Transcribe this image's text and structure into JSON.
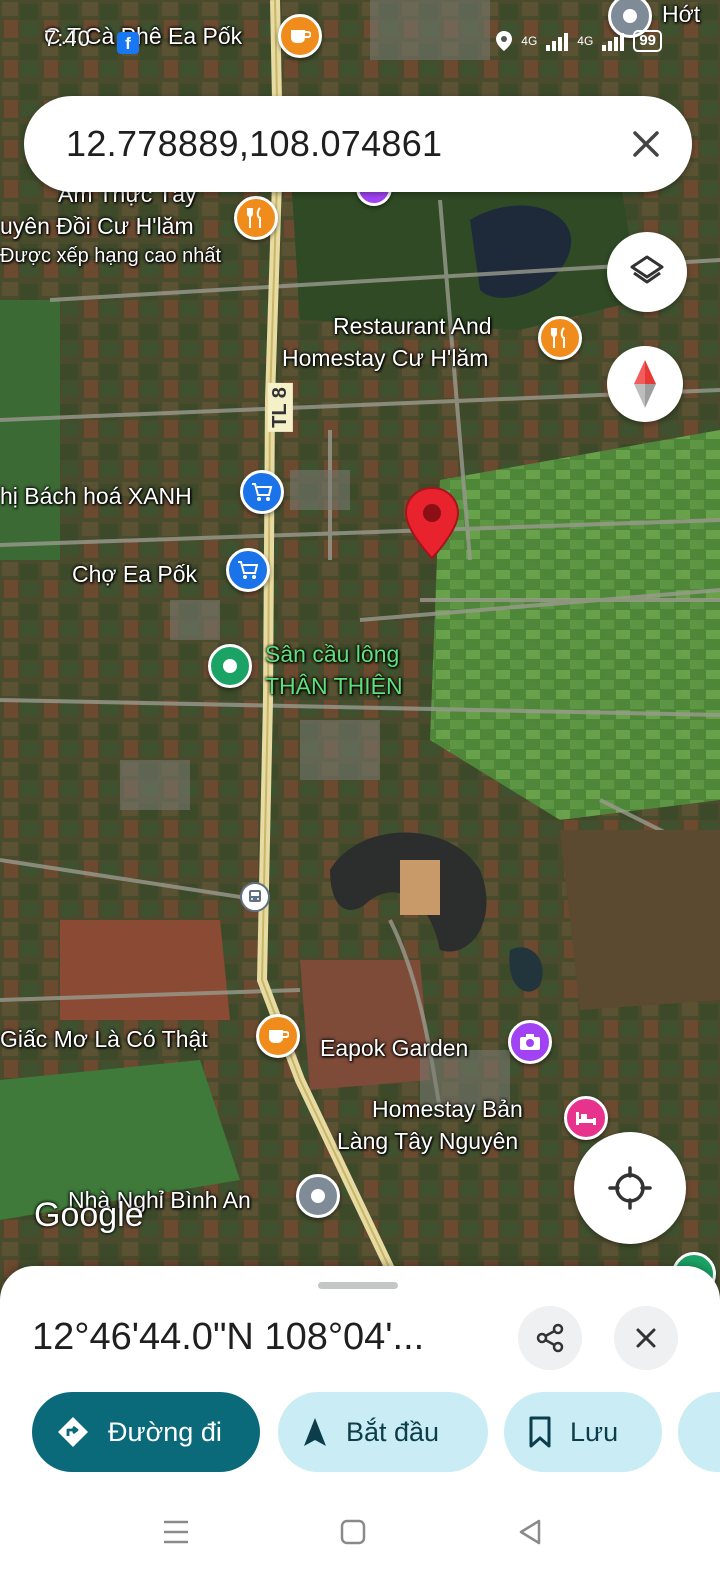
{
  "status_bar": {
    "time": "7:40",
    "notification_icon": "facebook-icon",
    "battery": "99",
    "network": [
      "4G",
      "4G"
    ]
  },
  "search": {
    "value": "12.778889,108.074861",
    "clear_icon": "close-icon"
  },
  "map": {
    "road_label": "TL 8",
    "places": [
      {
        "name": "C.T.Cà Phê Ea Pốk",
        "kind": "cafe"
      },
      {
        "name": "Ẩm Thực Tây",
        "kind": "restaurant"
      },
      {
        "name": "uyên Đồi Cư H'lăm",
        "kind": "restaurant"
      },
      {
        "name": "Được xếp hạng cao nhất",
        "kind": "restaurant-subtitle"
      },
      {
        "name": "Restaurant And",
        "kind": "restaurant"
      },
      {
        "name": "Homestay Cư H'lăm",
        "kind": "restaurant"
      },
      {
        "name": "hị Bách hoá XANH",
        "kind": "shopping"
      },
      {
        "name": "Chợ Ea Pốk",
        "kind": "shopping"
      },
      {
        "name": "Sân cầu lông",
        "kind": "sports"
      },
      {
        "name": "THÂN THIỆN",
        "kind": "sports"
      },
      {
        "name": "Giấc Mơ Là Có Thật",
        "kind": "cafe"
      },
      {
        "name": "Eapok Garden",
        "kind": "photo"
      },
      {
        "name": "Homestay Bản",
        "kind": "hotel"
      },
      {
        "name": "Làng Tây Nguyên",
        "kind": "hotel"
      },
      {
        "name": "Nhà Nghỉ Bình An",
        "kind": "lodging"
      },
      {
        "name": "Hớt",
        "kind": "service"
      }
    ],
    "attribution": "Google",
    "marker_icon": "dropped-pin-icon"
  },
  "controls": {
    "layers_icon": "layers-icon",
    "compass_icon": "compass-icon",
    "location_icon": "my-location-icon"
  },
  "sheet": {
    "title": "12°46'44.0\"N 108°04'...",
    "share_icon": "share-icon",
    "close_icon": "close-icon",
    "actions": [
      {
        "label": "Đường đi",
        "icon": "directions-icon"
      },
      {
        "label": "Bắt đầu",
        "icon": "navigation-arrow-icon"
      },
      {
        "label": "Lưu",
        "icon": "bookmark-icon"
      }
    ]
  },
  "nav": {
    "menu_icon": "recents-icon",
    "home_icon": "home-icon",
    "back_icon": "back-icon"
  }
}
